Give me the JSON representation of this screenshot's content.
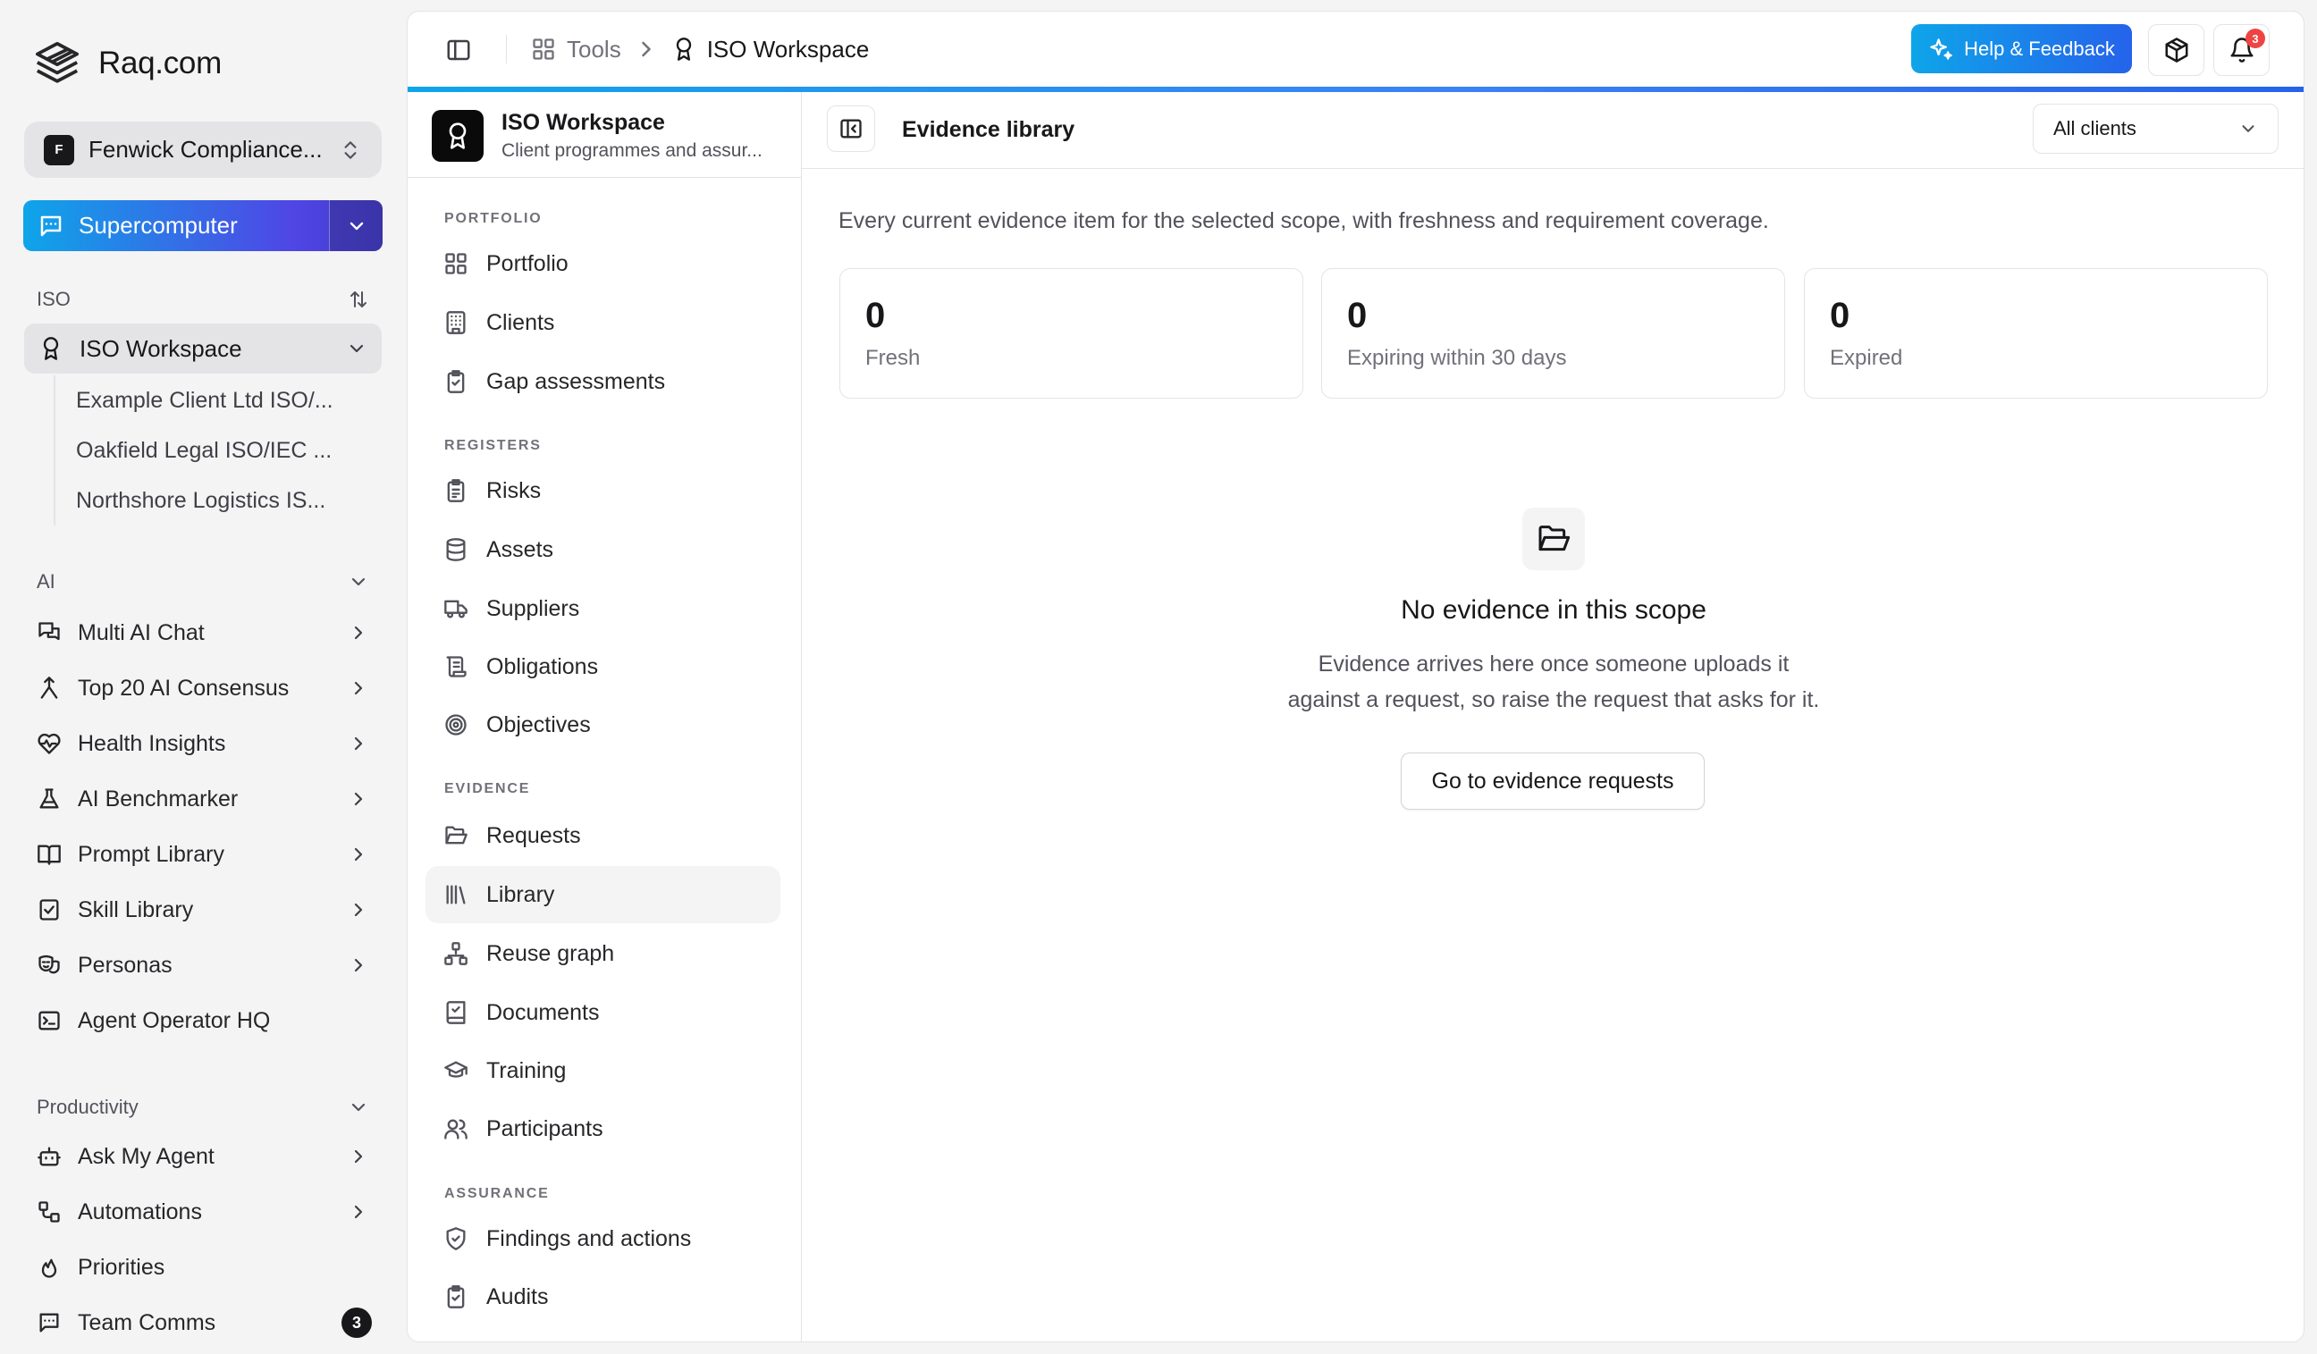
{
  "brand": {
    "name": "Raq.com"
  },
  "org": {
    "badge": "F",
    "name": "Fenwick Compliance..."
  },
  "supercomputer": {
    "label": "Supercomputer"
  },
  "iso_section": {
    "label": "ISO",
    "workspace": {
      "label": "ISO Workspace"
    },
    "sub_items": [
      {
        "label": "Example Client Ltd ISO/..."
      },
      {
        "label": "Oakfield Legal ISO/IEC ..."
      },
      {
        "label": "Northshore Logistics IS..."
      }
    ]
  },
  "ai_section": {
    "label": "AI",
    "items": [
      {
        "label": "Multi AI Chat",
        "icon": "chat-bubbles-icon"
      },
      {
        "label": "Top 20 AI Consensus",
        "icon": "merge-icon"
      },
      {
        "label": "Health Insights",
        "icon": "heart-pulse-icon"
      },
      {
        "label": "AI Benchmarker",
        "icon": "flask-icon"
      },
      {
        "label": "Prompt Library",
        "icon": "book-open-icon"
      },
      {
        "label": "Skill Library",
        "icon": "clipboard-check-icon"
      },
      {
        "label": "Personas",
        "icon": "drama-masks-icon"
      },
      {
        "label": "Agent Operator HQ",
        "icon": "terminal-icon"
      }
    ]
  },
  "productivity_section": {
    "label": "Productivity",
    "items": [
      {
        "label": "Ask My Agent",
        "icon": "bot-icon"
      },
      {
        "label": "Automations",
        "icon": "workflow-icon"
      },
      {
        "label": "Priorities",
        "icon": "flame-icon"
      },
      {
        "label": "Team Comms",
        "icon": "message-square-icon",
        "badge": "3"
      }
    ]
  },
  "breadcrumb": {
    "tools": "Tools",
    "current": "ISO Workspace"
  },
  "header": {
    "help_label": "Help & Feedback",
    "notification_count": "3"
  },
  "workspace": {
    "title": "ISO Workspace",
    "subtitle": "Client programmes and assur..."
  },
  "nav": {
    "portfolio_label": "PORTFOLIO",
    "portfolio": [
      "Portfolio",
      "Clients",
      "Gap assessments"
    ],
    "registers_label": "REGISTERS",
    "registers": [
      "Risks",
      "Assets",
      "Suppliers",
      "Obligations",
      "Objectives"
    ],
    "evidence_label": "EVIDENCE",
    "evidence": [
      "Requests",
      "Library",
      "Reuse graph",
      "Documents",
      "Training",
      "Participants"
    ],
    "assurance_label": "ASSURANCE",
    "assurance": [
      "Findings and actions",
      "Audits"
    ],
    "active": "Library"
  },
  "content": {
    "title": "Evidence library",
    "client_filter": "All clients",
    "intro": "Every current evidence item for the selected scope, with freshness and requirement coverage.",
    "stats": [
      {
        "value": "0",
        "label": "Fresh"
      },
      {
        "value": "0",
        "label": "Expiring within 30 days"
      },
      {
        "value": "0",
        "label": "Expired"
      }
    ],
    "empty": {
      "title": "No evidence in this scope",
      "line1": "Evidence arrives here once someone uploads it",
      "line2": "against a request, so raise the request that asks for it.",
      "button": "Go to evidence requests"
    }
  },
  "colors": {
    "accent_start": "#0ea5e9",
    "accent_end": "#4f46e5",
    "alert": "#ef4444"
  }
}
